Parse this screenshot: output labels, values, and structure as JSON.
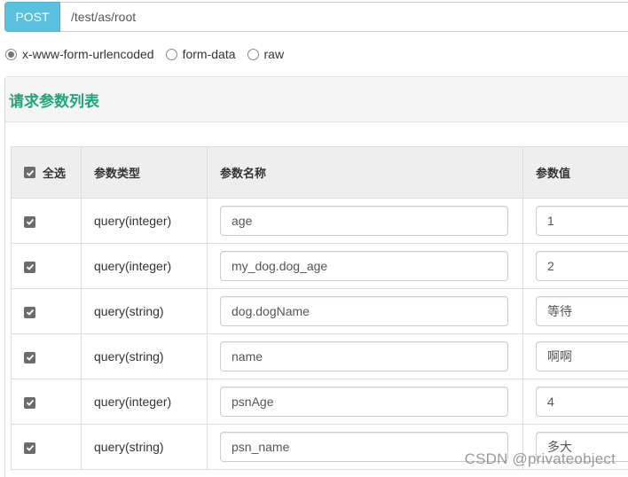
{
  "request": {
    "method": "POST",
    "url": "/test/as/root",
    "method_color": "#5bc0de"
  },
  "body_types": {
    "options": [
      {
        "label": "x-www-form-urlencoded",
        "checked": true
      },
      {
        "label": "form-data",
        "checked": false
      },
      {
        "label": "raw",
        "checked": false
      }
    ]
  },
  "panel": {
    "title": "请求参数列表",
    "title_color": "#1fa67a"
  },
  "table": {
    "headers": {
      "select_all": "全选",
      "type": "参数类型",
      "name": "参数名称",
      "value": "参数值"
    },
    "select_all_checked": true,
    "rows": [
      {
        "checked": true,
        "type": "query(integer)",
        "name": "age",
        "value": "1"
      },
      {
        "checked": true,
        "type": "query(integer)",
        "name": "my_dog.dog_age",
        "value": "2"
      },
      {
        "checked": true,
        "type": "query(string)",
        "name": "dog.dogName",
        "value": "等待"
      },
      {
        "checked": true,
        "type": "query(string)",
        "name": "name",
        "value": "啊啊"
      },
      {
        "checked": true,
        "type": "query(integer)",
        "name": "psnAge",
        "value": "4"
      },
      {
        "checked": true,
        "type": "query(string)",
        "name": "psn_name",
        "value": "多大"
      }
    ]
  },
  "watermark": "CSDN @privateobject"
}
